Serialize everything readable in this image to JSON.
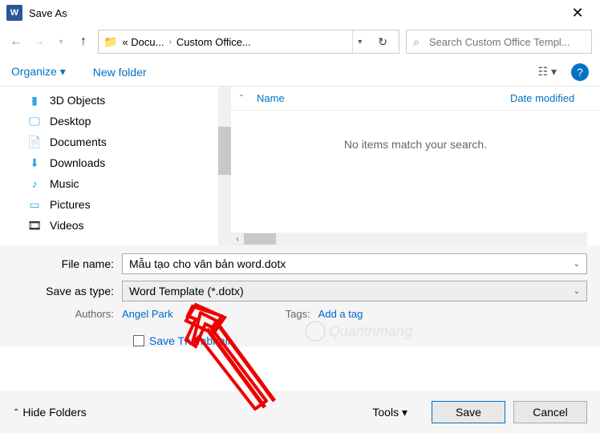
{
  "titlebar": {
    "title": "Save As"
  },
  "nav": {
    "crumb1": "« Docu...",
    "crumb2": "Custom Office..."
  },
  "search": {
    "placeholder": "Search Custom Office Templ..."
  },
  "toolbar": {
    "organize": "Organize ▾",
    "newfolder": "New folder"
  },
  "tree": {
    "items": [
      {
        "icon": "🧊",
        "label": "3D Objects"
      },
      {
        "icon": "🖥️",
        "label": "Desktop"
      },
      {
        "icon": "📄",
        "label": "Documents"
      },
      {
        "icon": "⬇",
        "label": "Downloads"
      },
      {
        "icon": "🎵",
        "label": "Music"
      },
      {
        "icon": "🖼️",
        "label": "Pictures"
      },
      {
        "icon": "🎞️",
        "label": "Videos"
      }
    ]
  },
  "list": {
    "col_name": "Name",
    "col_date": "Date modified",
    "empty": "No items match your search."
  },
  "form": {
    "filename_label": "File name:",
    "filename_value": "Mẫu tạo cho văn bản word.dotx",
    "type_label": "Save as type:",
    "type_value": "Word Template (*.dotx)",
    "authors_label": "Authors:",
    "authors_value": "Angel Park",
    "tags_label": "Tags:",
    "tags_value": "Add a tag",
    "thumb_label": "Save Thumbnail"
  },
  "footer": {
    "hide": "Hide Folders",
    "tools": "Tools   ▾",
    "save": "Save",
    "cancel": "Cancel"
  },
  "watermark": "Quantrimang"
}
